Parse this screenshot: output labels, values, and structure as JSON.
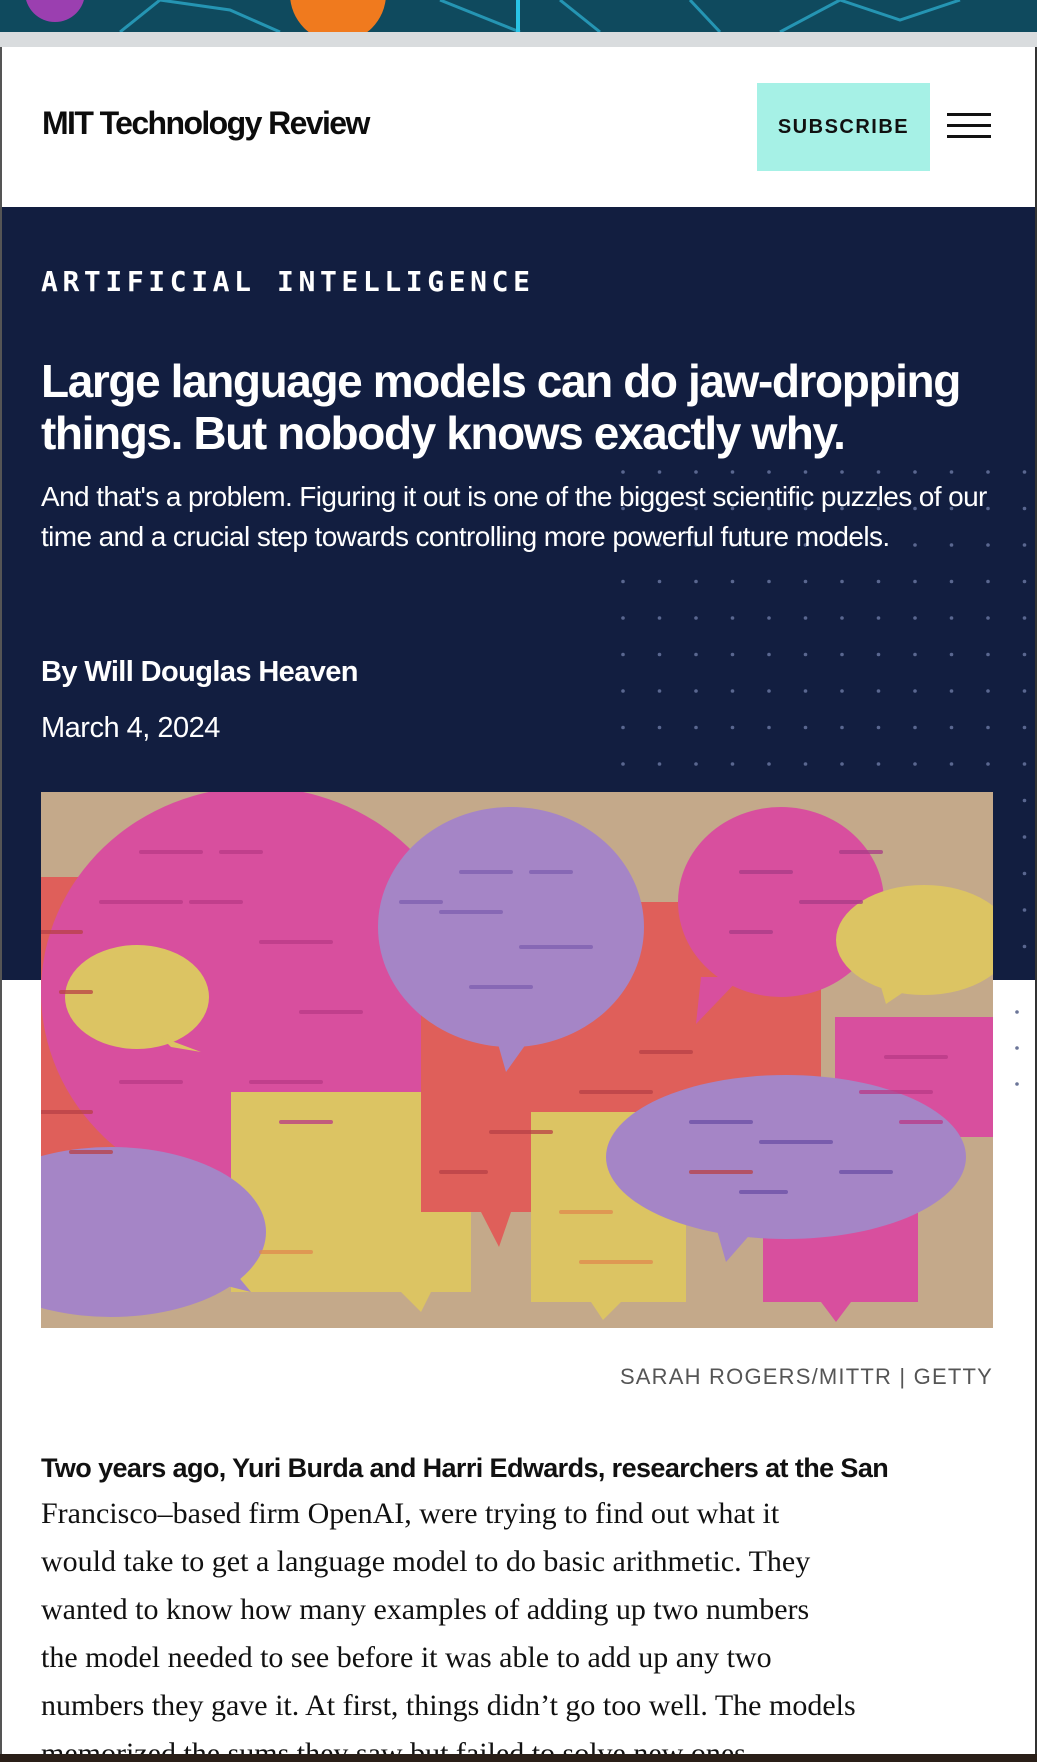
{
  "header": {
    "logo": "MIT Technology Review",
    "subscribe_label": "SUBSCRIBE"
  },
  "hero": {
    "topic": "ARTIFICIAL INTELLIGENCE",
    "headline": "Large language models can do jaw-dropping things. But nobody knows exactly why.",
    "dek": "And that's a problem. Figuring it out is one of the biggest scientific puzzles of our time and a crucial step towards controlling more powerful future models.",
    "byline": "By Will Douglas Heaven",
    "date": "March 4, 2024"
  },
  "image": {
    "credit": "SARAH ROGERS/MITTR | GETTY"
  },
  "article": {
    "lede_bold": "Two years ago, Yuri Burda and Harri Edwards, researchers at the San",
    "lines": [
      "Francisco–based firm OpenAI, were trying to find out what it",
      "would take to get a language model to do basic arithmetic. They",
      "wanted to know how many examples of adding up two numbers",
      "the model needed to see before it was able to add up any two",
      "numbers they gave it. At first, things didn’t go too well. The models",
      "memorized the sums they saw but failed to solve new ones."
    ]
  },
  "colors": {
    "hero_bg": "#121e40",
    "subscribe_bg": "#a6f1e6",
    "pink": "#d84f9e",
    "purple": "#a585c6",
    "coral": "#df5f5a",
    "yellow": "#dcc463",
    "paper": "#c4a98a"
  },
  "icons": {
    "menu": "hamburger-menu-icon"
  }
}
